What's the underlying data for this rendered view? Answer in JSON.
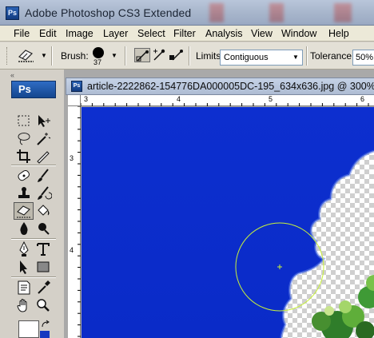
{
  "window": {
    "title": "Adobe Photoshop CS3 Extended",
    "logo_text": "Ps"
  },
  "menubar": {
    "items": [
      "File",
      "Edit",
      "Image",
      "Layer",
      "Select",
      "Filter",
      "Analysis",
      "View",
      "Window",
      "Help"
    ]
  },
  "options": {
    "brush_label": "Brush:",
    "brush_size": "37",
    "limits_label": "Limits:",
    "limits_value": "Contiguous",
    "tolerance_label": "Tolerance:",
    "tolerance_value": "50%"
  },
  "toolbox": {
    "header": "Ps",
    "collapse_glyph": "«",
    "tools": [
      "marquee-tool",
      "move-tool",
      "lasso-tool",
      "magic-wand-tool",
      "crop-tool",
      "slice-tool",
      "healing-brush-tool",
      "brush-tool",
      "clone-stamp-tool",
      "history-brush-tool",
      "background-eraser-tool",
      "paint-bucket-tool",
      "blur-tool",
      "dodge-tool",
      "pen-tool",
      "type-tool",
      "path-selection-tool",
      "rectangle-tool",
      "notes-tool",
      "eyedropper-tool",
      "hand-tool",
      "zoom-tool"
    ],
    "active_tool": "background-eraser-tool",
    "foreground_color": "#ffffff",
    "background_color": "#1538c0"
  },
  "document": {
    "title": "article-2222862-154776DA000005DC-195_634x636.jpg @ 300% (Layer",
    "ruler_top_labels": [
      "3",
      "4",
      "5",
      "6"
    ],
    "ruler_left_labels": [
      "3",
      "4"
    ],
    "sky_color": "#0a2fd2",
    "brush_cursor_color": "#c8f23a"
  }
}
